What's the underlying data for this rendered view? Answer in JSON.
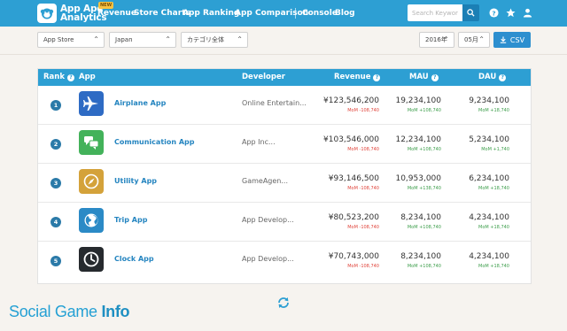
{
  "brand": {
    "line1": "App Ape",
    "line2": "Analytics"
  },
  "nav": {
    "items": [
      "Revenue",
      "Store Charts",
      "App Ranking",
      "App Comparison",
      "Console",
      "Blog"
    ],
    "new_badge": "NEW"
  },
  "search": {
    "placeholder": "Search Keyword"
  },
  "filters": {
    "store": "App Store",
    "country": "Japan",
    "category": "カテゴリ全体",
    "year": "2016年",
    "month": "05月",
    "csv_label": "CSV"
  },
  "table": {
    "headers": {
      "rank": "Rank",
      "app": "App",
      "developer": "Developer",
      "revenue": "Revenue",
      "mau": "MAU",
      "dau": "DAU"
    },
    "help_glyph": "?",
    "rows": [
      {
        "rank": "1",
        "name": "Airplane App",
        "developer": "Online Entertain...",
        "revenue": "¥123,546,200",
        "revenue_mom": "MoM -108,740",
        "mau": "19,234,100",
        "mau_mom": "MoM +108,740",
        "dau": "9,234,100",
        "dau_mom": "MoM +18,740",
        "icon": "airplane-icon",
        "color": "#2e6bc4"
      },
      {
        "rank": "2",
        "name": "Communication App",
        "developer": "App Inc...",
        "revenue": "¥103,546,000",
        "revenue_mom": "MoM -108,740",
        "mau": "12,234,100",
        "mau_mom": "MoM +108,740",
        "dau": "5,234,100",
        "dau_mom": "MoM +1,740",
        "icon": "chat-icon",
        "color": "#43b25a"
      },
      {
        "rank": "3",
        "name": "Utility App",
        "developer": "GameAgen...",
        "revenue": "¥93,146,500",
        "revenue_mom": "MoM -108,740",
        "mau": "10,953,000",
        "mau_mom": "MoM +138,740",
        "dau": "6,234,100",
        "dau_mom": "MoM +18,740",
        "icon": "compass-icon",
        "color": "#d4a23a"
      },
      {
        "rank": "4",
        "name": "Trip App",
        "developer": "App Develop...",
        "revenue": "¥80,523,200",
        "revenue_mom": "MoM -108,740",
        "mau": "8,234,100",
        "mau_mom": "MoM +108,740",
        "dau": "4,234,100",
        "dau_mom": "MoM +18,740",
        "icon": "globe-icon",
        "color": "#2b8ac6"
      },
      {
        "rank": "5",
        "name": "Clock App",
        "developer": "App Develop...",
        "revenue": "¥70,743,000",
        "revenue_mom": "MoM -108,740",
        "mau": "8,234,100",
        "mau_mom": "MoM +108,740",
        "dau": "4,234,100",
        "dau_mom": "MoM +18,740",
        "icon": "clock-icon",
        "color": "#262a2e"
      }
    ]
  },
  "watermark": {
    "light": "Social Game ",
    "bold": "Info"
  }
}
